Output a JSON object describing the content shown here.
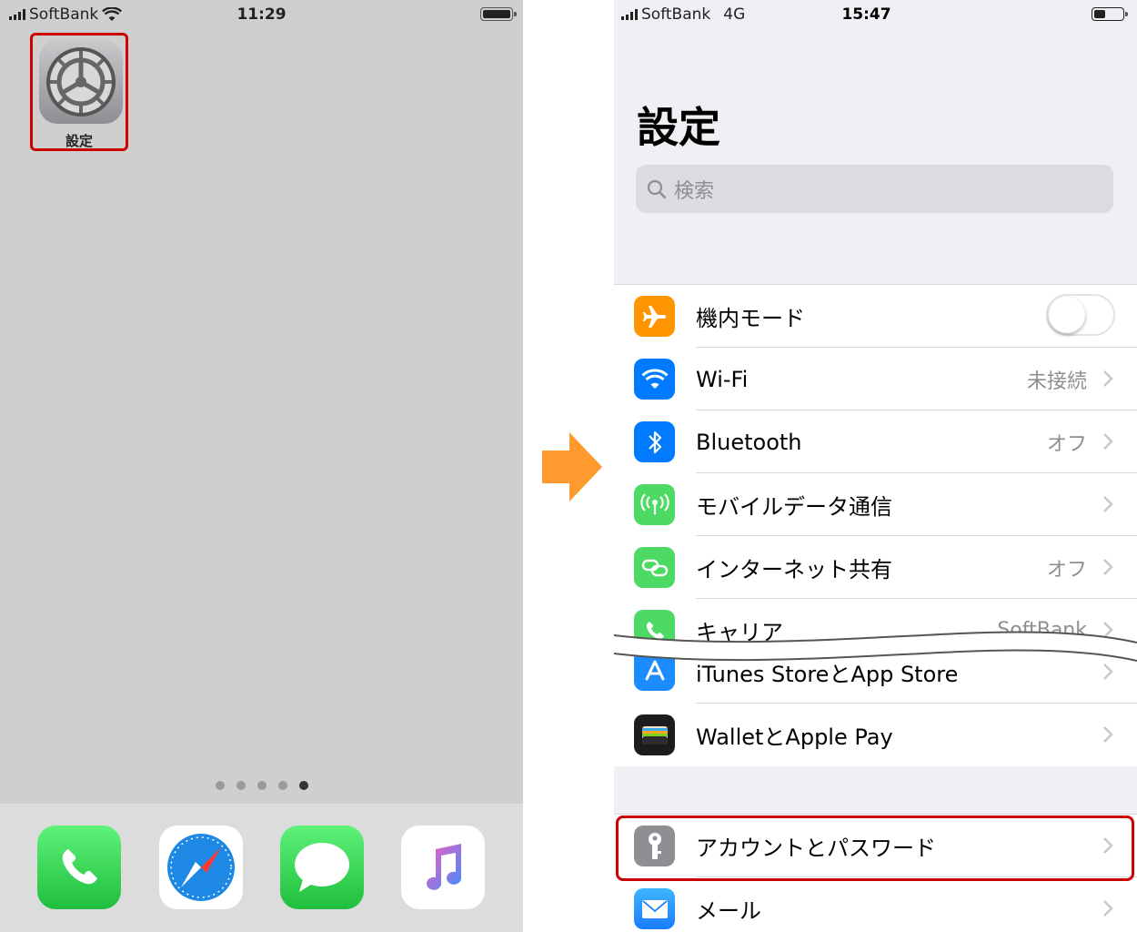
{
  "left": {
    "status": {
      "carrier": "SoftBank",
      "time": "11:29"
    },
    "settings_app": {
      "label": "設定"
    },
    "page_dots": {
      "count": 5,
      "active_index": 4
    },
    "dock": [
      {
        "name": "phone",
        "color": "#34c759"
      },
      {
        "name": "safari",
        "color": "#1e88e5"
      },
      {
        "name": "messages",
        "color": "#34c759"
      },
      {
        "name": "music",
        "color": "#fc3c44"
      }
    ]
  },
  "right": {
    "status": {
      "carrier": "SoftBank",
      "network": "4G",
      "time": "15:47"
    },
    "title": "設定",
    "search": {
      "placeholder": "検索"
    },
    "rows": [
      {
        "label": "機内モード",
        "icon": "airplane-icon",
        "color": "#ff9500",
        "toggle": false
      },
      {
        "label": "Wi-Fi",
        "value": "未接続",
        "icon": "wifi-icon",
        "color": "#007aff"
      },
      {
        "label": "Bluetooth",
        "value": "オフ",
        "icon": "bluetooth-icon",
        "color": "#007aff"
      },
      {
        "label": "モバイルデータ通信",
        "value": "",
        "icon": "antenna-icon",
        "color": "#4cd964"
      },
      {
        "label": "インターネット共有",
        "value": "オフ",
        "icon": "hotspot-icon",
        "color": "#4cd964"
      },
      {
        "label": "キャリア",
        "value": "SoftBank",
        "icon": "phone-icon",
        "color": "#4cd964"
      },
      {
        "label": "iTunes StoreとApp Store",
        "icon": "appstore-icon",
        "color": "#1a8cff"
      },
      {
        "label": "WalletとApple Pay",
        "icon": "wallet-icon",
        "color": "#1c1c1e"
      }
    ],
    "rows2": [
      {
        "label": "アカウントとパスワード",
        "icon": "key-icon",
        "color": "#8e8e93"
      },
      {
        "label": "メール",
        "icon": "mail-icon",
        "color": "#1a8cff"
      }
    ]
  }
}
